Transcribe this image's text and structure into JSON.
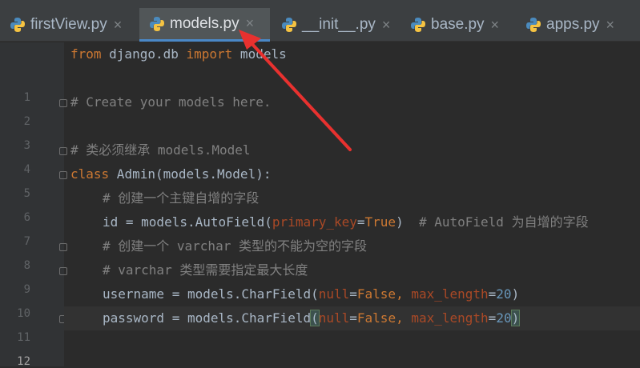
{
  "tabs": [
    {
      "label": "firstView.py",
      "icon": "python-file-icon",
      "active": false
    },
    {
      "label": "models.py",
      "icon": "python-file-icon",
      "active": true
    },
    {
      "label": "__init__.py",
      "icon": "python-file-icon",
      "active": false
    },
    {
      "label": "base.py",
      "icon": "python-file-icon",
      "active": false
    },
    {
      "label": "apps.py",
      "icon": "python-file-icon",
      "active": false
    }
  ],
  "close_glyph": "×",
  "line_numbers": [
    "1",
    "2",
    "3",
    "4",
    "5",
    "6",
    "7",
    "8",
    "9",
    "10",
    "11",
    "12"
  ],
  "current_line": "12",
  "code": {
    "l1": {
      "kw1": "from",
      "t1": " django.db ",
      "kw2": "import",
      "t2": " models"
    },
    "l3": {
      "comment": "# Create your models here."
    },
    "l5": {
      "comment": "# 类必须继承 models.Model"
    },
    "l6": {
      "kw": "class",
      "t": " Admin(models.Model):"
    },
    "l7": {
      "comment": "# 创建一个主键自增的字段"
    },
    "l8": {
      "t1": "id = models.AutoField(",
      "param": "primary_key",
      "eq": "=",
      "val": "True",
      "t2": ")  ",
      "comment": "# AutoField 为自增的字段"
    },
    "l9": {
      "comment": "# 创建一个 varchar 类型的不能为空的字段"
    },
    "l10": {
      "comment": "# varchar 类型需要指定最大长度"
    },
    "l11": {
      "t1": "username = models.CharField(",
      "p1": "null",
      "eq1": "=",
      "v1": "False",
      "sep": ", ",
      "p2": "max_length",
      "eq2": "=",
      "v2": "20",
      "t2": ")"
    },
    "l12": {
      "t1": "password = models.CharField",
      "open": "(",
      "p1": "null",
      "eq1": "=",
      "v1": "False",
      "sep": ", ",
      "p2": "max_length",
      "eq2": "=",
      "v2": "20",
      "close": ")"
    }
  },
  "colors": {
    "background": "#2b2b2b",
    "keyword": "#cc7832",
    "comment": "#808080",
    "number": "#6897bb",
    "param": "#aa4926",
    "annotation_arrow": "#e8312f"
  }
}
